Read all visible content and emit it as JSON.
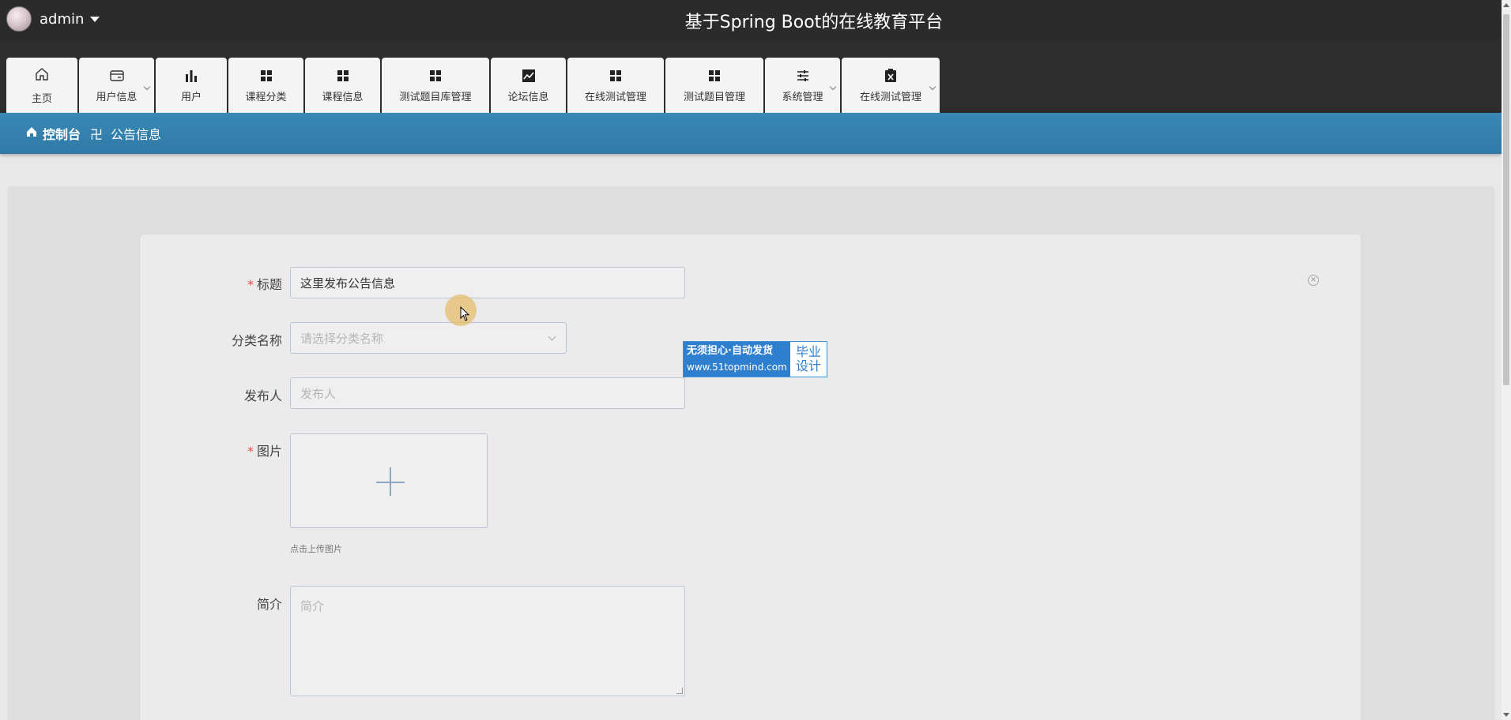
{
  "header": {
    "username": "admin",
    "site_title": "基于Spring Boot的在线教育平台"
  },
  "nav": {
    "tabs": [
      {
        "label": "主页",
        "icon": "home-icon",
        "has_dropdown": false
      },
      {
        "label": "用户信息",
        "icon": "wallet-icon",
        "has_dropdown": true
      },
      {
        "label": "用户",
        "icon": "bar-chart-icon",
        "has_dropdown": false
      },
      {
        "label": "课程分类",
        "icon": "grid-icon",
        "has_dropdown": false
      },
      {
        "label": "课程信息",
        "icon": "grid-icon",
        "has_dropdown": false
      },
      {
        "label": "测试题目库管理",
        "icon": "grid-icon",
        "has_dropdown": false
      },
      {
        "label": "论坛信息",
        "icon": "line-chart-icon",
        "has_dropdown": false
      },
      {
        "label": "在线测试管理",
        "icon": "grid-icon",
        "has_dropdown": false
      },
      {
        "label": "测试题目管理",
        "icon": "grid-icon",
        "has_dropdown": false
      },
      {
        "label": "系统管理",
        "icon": "sliders-icon",
        "has_dropdown": true
      },
      {
        "label": "在线测试管理",
        "icon": "clipboard-x-icon",
        "has_dropdown": true
      }
    ]
  },
  "breadcrumb": {
    "home": "控制台",
    "separator": "卍",
    "current": "公告信息"
  },
  "form": {
    "title_label": "标题",
    "title_value": "这里发布公告信息",
    "category_label": "分类名称",
    "category_placeholder": "请选择分类名称",
    "publisher_label": "发布人",
    "publisher_placeholder": "发布人",
    "image_label": "图片",
    "upload_tip": "点击上传图片",
    "intro_label": "简介",
    "intro_placeholder": "简介"
  },
  "badge": {
    "line1": "无须担心·自动发货",
    "line2": "www.51topmind.com",
    "right1": "毕业",
    "right2": "设计"
  },
  "colors": {
    "topbar": "#2b2b2b",
    "breadcrumb_bar": "#3582b0",
    "required": "#e64a4a"
  }
}
